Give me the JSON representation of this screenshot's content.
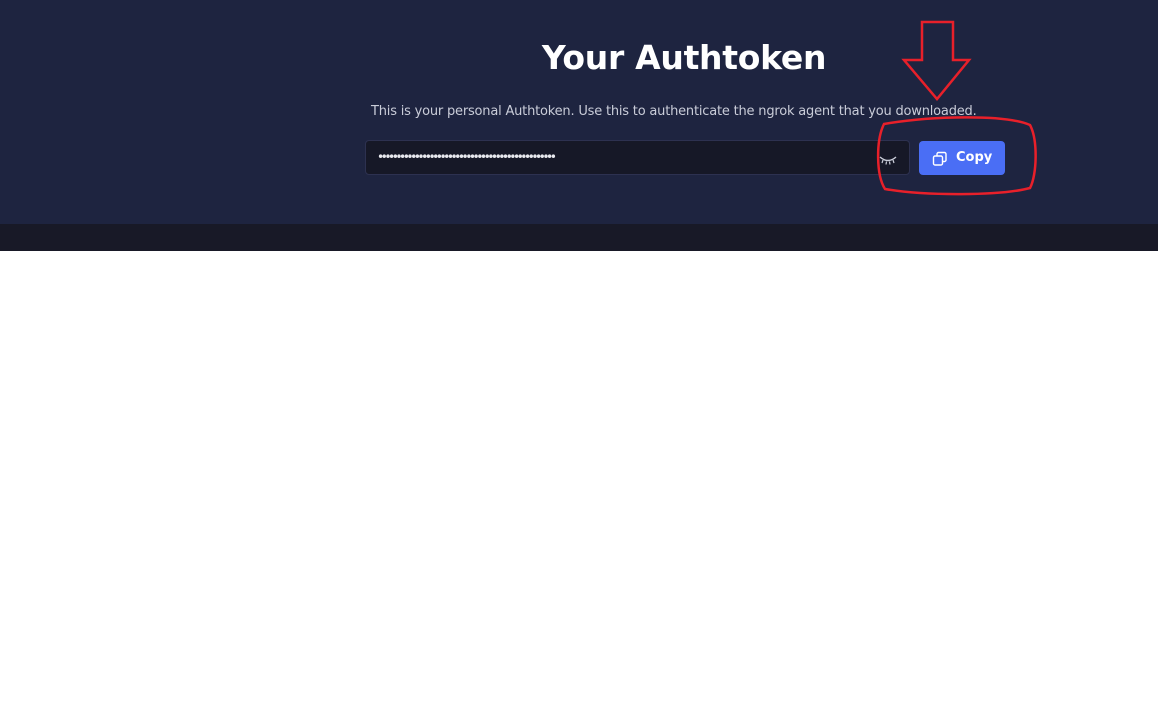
{
  "header": {
    "title": "Your Authtoken",
    "description": "This is your personal Authtoken. Use this to authenticate the ngrok agent that you downloaded."
  },
  "token": {
    "masked_value": "••••••••••••••••••••••••••••••••••••••••••••••••",
    "visibility_icon": "eye-closed-icon"
  },
  "copy": {
    "label": "Copy",
    "icon": "copy-icon"
  },
  "colors": {
    "hero_background": "#1e2440",
    "strip_background": "#181927",
    "field_background": "#161827",
    "button_accent": "#4a6ef5",
    "annotation": "#e8202a"
  }
}
